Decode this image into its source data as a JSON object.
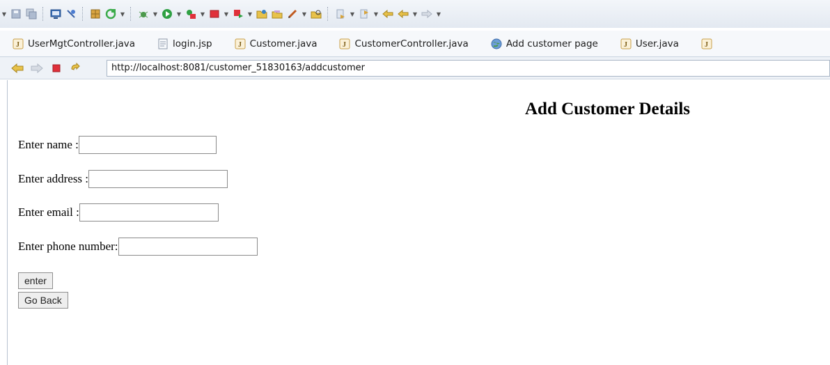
{
  "tabs": [
    {
      "label": "UserMgtController.java",
      "icon": "java-file-icon"
    },
    {
      "label": "login.jsp",
      "icon": "jsp-file-icon"
    },
    {
      "label": "Customer.java",
      "icon": "java-file-icon"
    },
    {
      "label": "CustomerController.java",
      "icon": "java-file-icon"
    },
    {
      "label": "Add customer page",
      "icon": "globe-icon"
    },
    {
      "label": "User.java",
      "icon": "java-file-icon"
    }
  ],
  "browser": {
    "url": "http://localhost:8081/customer_51830163/addcustomer"
  },
  "page": {
    "title": "Add Customer Details",
    "fields": {
      "name_label": "Enter name :",
      "name_value": "",
      "address_label": "Enter address :",
      "address_value": "",
      "email_label": "Enter email :",
      "email_value": "",
      "phone_label": "Enter phone number:",
      "phone_value": ""
    },
    "enter_label": "enter",
    "back_label": "Go Back"
  },
  "colors": {
    "toolbar_bg": "#e3e9f1",
    "java_icon": "#c8a04a",
    "run_green": "#2ea043",
    "stop_red": "#e0303a",
    "nav_yellow": "#e8c24a"
  }
}
